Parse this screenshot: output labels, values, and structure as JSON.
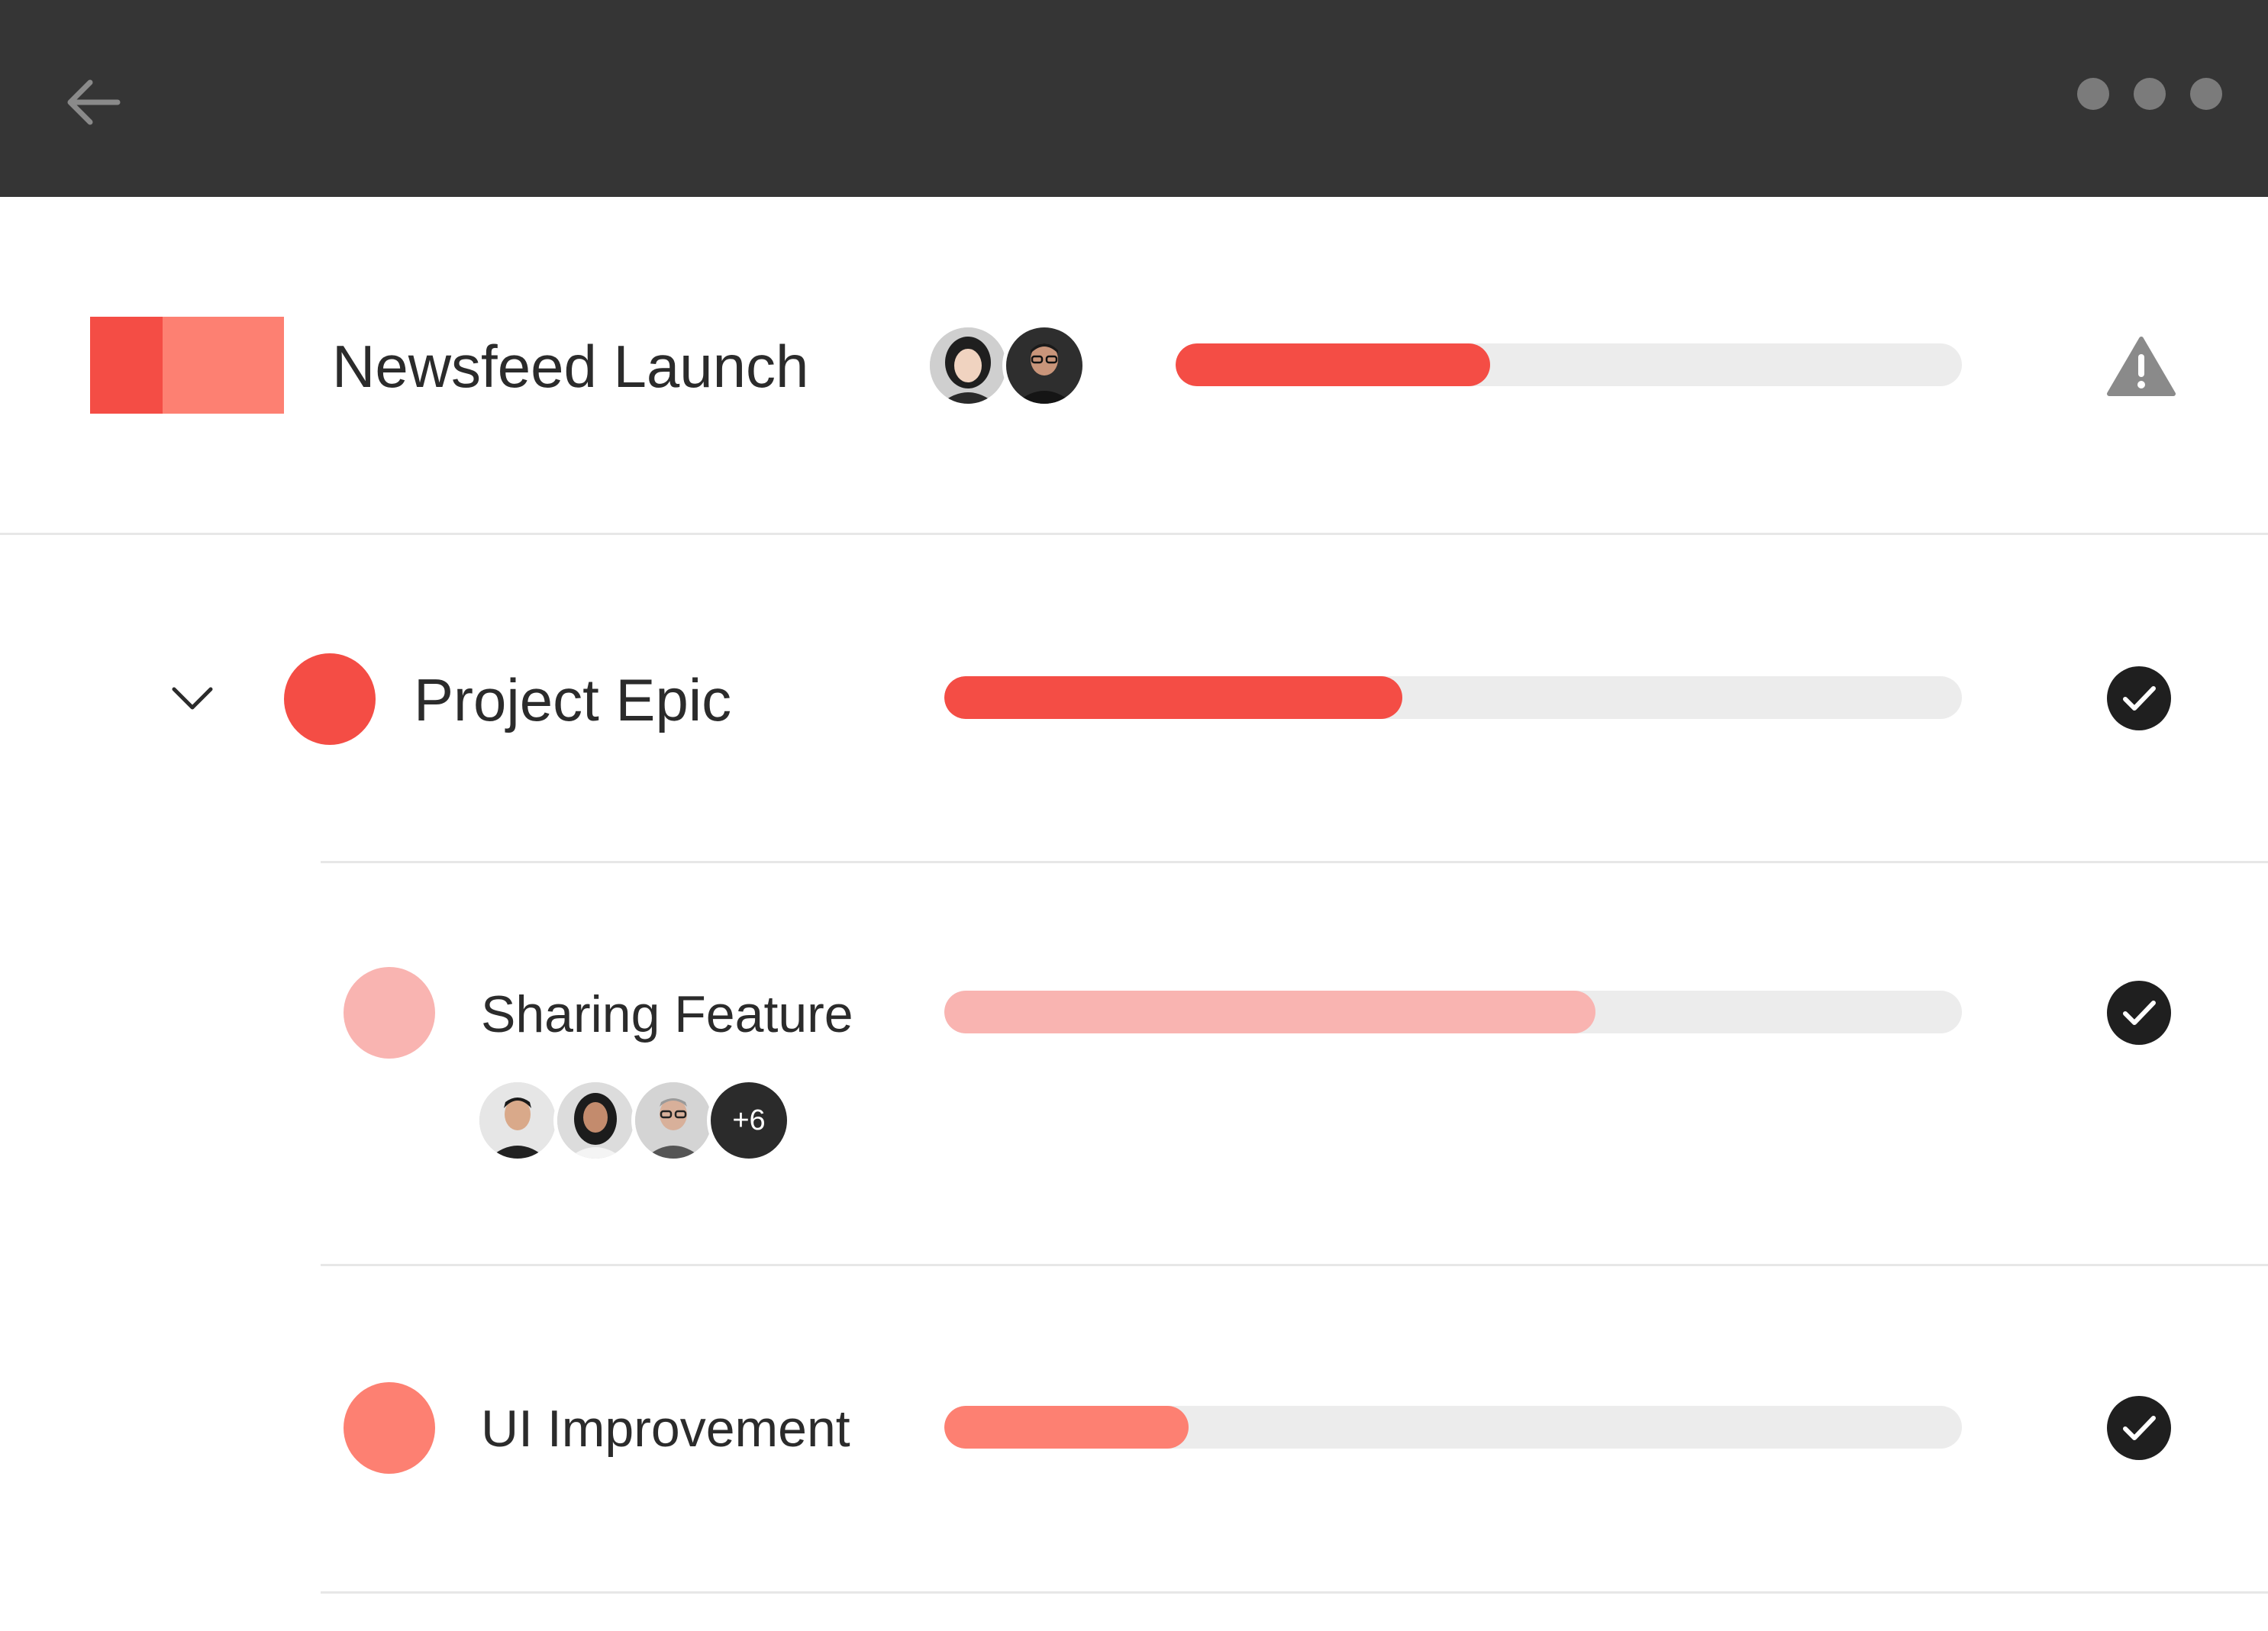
{
  "colors": {
    "topbar": "#353535",
    "primary_red": "#f44d45",
    "salmon": "#fd8072",
    "light_pink": "#f9b4b1",
    "track": "#ececec",
    "icon_gray": "#8a8a8a",
    "check_dark": "#1f1f1f"
  },
  "header": {
    "back_icon": "arrow-left-icon",
    "menu_icon": "more-horizontal-icon"
  },
  "project": {
    "title": "Newsfeed Launch",
    "progress": 0.4,
    "status_icon": "warning-triangle-icon",
    "avatars": [
      "avatar-woman",
      "avatar-man-glasses"
    ]
  },
  "epic": {
    "title": "Project Epic",
    "progress": 0.45,
    "status_icon": "check-circle-icon",
    "expand_icon": "chevron-down-icon"
  },
  "tasks": [
    {
      "title": "Sharing Feature",
      "progress": 0.64,
      "status_icon": "check-circle-icon",
      "avatars": [
        "avatar-man",
        "avatar-woman-2",
        "avatar-man-gray"
      ],
      "more_count": "+6"
    },
    {
      "title": "UI Improvement",
      "progress": 0.24,
      "status_icon": "check-circle-icon"
    }
  ]
}
